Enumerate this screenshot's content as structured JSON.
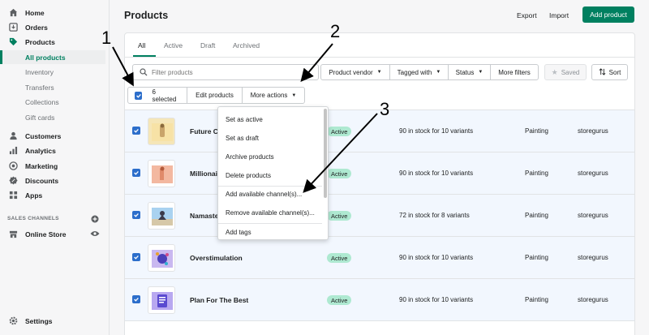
{
  "sidebar": {
    "items": [
      {
        "label": "Home",
        "icon": "home-icon"
      },
      {
        "label": "Orders",
        "icon": "orders-icon"
      },
      {
        "label": "Products",
        "icon": "tag-icon"
      }
    ],
    "product_sub": [
      {
        "label": "All products"
      },
      {
        "label": "Inventory"
      },
      {
        "label": "Transfers"
      },
      {
        "label": "Collections"
      },
      {
        "label": "Gift cards"
      }
    ],
    "items2": [
      {
        "label": "Customers",
        "icon": "person-icon"
      },
      {
        "label": "Analytics",
        "icon": "bar-chart-icon"
      },
      {
        "label": "Marketing",
        "icon": "target-icon"
      },
      {
        "label": "Discounts",
        "icon": "discount-icon"
      },
      {
        "label": "Apps",
        "icon": "apps-icon"
      }
    ],
    "sales_channels_label": "SALES CHANNELS",
    "online_store": "Online Store",
    "settings": "Settings"
  },
  "header": {
    "title": "Products",
    "export": "Export",
    "import": "Import",
    "add_product": "Add product"
  },
  "tabs": [
    "All",
    "Active",
    "Draft",
    "Archived"
  ],
  "search": {
    "placeholder": "Filter products"
  },
  "filters": {
    "vendor": "Product vendor",
    "tagged": "Tagged with",
    "status": "Status",
    "more": "More filters",
    "saved": "Saved",
    "sort": "Sort"
  },
  "bulk": {
    "selected": "6 selected",
    "edit": "Edit products",
    "more_actions": "More actions"
  },
  "dropdown": [
    "Set as active",
    "Set as draft",
    "Archive products",
    "Delete products",
    "Add available channel(s)...",
    "Remove available channel(s)...",
    "Add tags"
  ],
  "rows": [
    {
      "title": "Future Cy",
      "status": "Active",
      "inventory": "90 in stock for 10 variants",
      "type": "Painting",
      "vendor": "storegurus"
    },
    {
      "title": "Millionair",
      "status": "Active",
      "inventory": "90 in stock for 10 variants",
      "type": "Painting",
      "vendor": "storegurus"
    },
    {
      "title": "Namaste",
      "status": "Active",
      "inventory": "72 in stock for 8 variants",
      "type": "Painting",
      "vendor": "storegurus"
    },
    {
      "title": "Overstimulation",
      "status": "Active",
      "inventory": "90 in stock for 10 variants",
      "type": "Painting",
      "vendor": "storegurus"
    },
    {
      "title": "Plan For The Best",
      "status": "Active",
      "inventory": "90 in stock for 10 variants",
      "type": "Painting",
      "vendor": "storegurus"
    }
  ],
  "annotations": [
    "1",
    "2",
    "3"
  ],
  "colors": {
    "brand": "#008060",
    "selected_row": "#f2f7fe",
    "badge": "#aee9d1",
    "checkbox": "#2c6ecb"
  }
}
